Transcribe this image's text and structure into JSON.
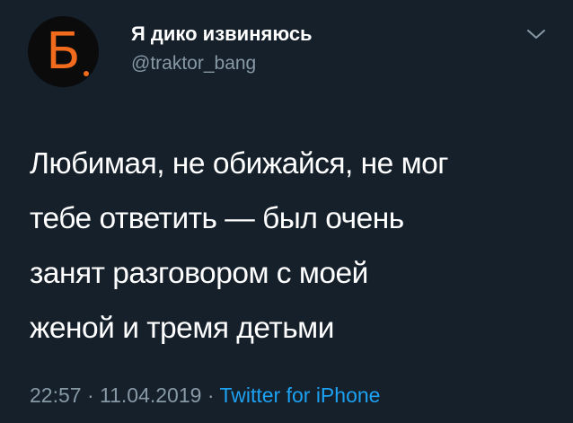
{
  "tweet": {
    "author": {
      "display_name": "Я дико извиняюсь",
      "handle": "@traktor_bang",
      "avatar_letter": "Б",
      "avatar_accent_color": "#f26a1b"
    },
    "menu_icon": "chevron-down-icon",
    "text_lines": [
      "Любимая, не обижайся, не мог",
      "тебе ответить — был очень",
      "занят разговором с моей",
      "женой и тремя детьми"
    ],
    "time": "22:57",
    "separator": "·",
    "date": "11.04.2019",
    "source": "Twitter for iPhone"
  },
  "colors": {
    "background": "#15202b",
    "text": "#ffffff",
    "secondary": "#8899a6",
    "link": "#1da1f2"
  }
}
